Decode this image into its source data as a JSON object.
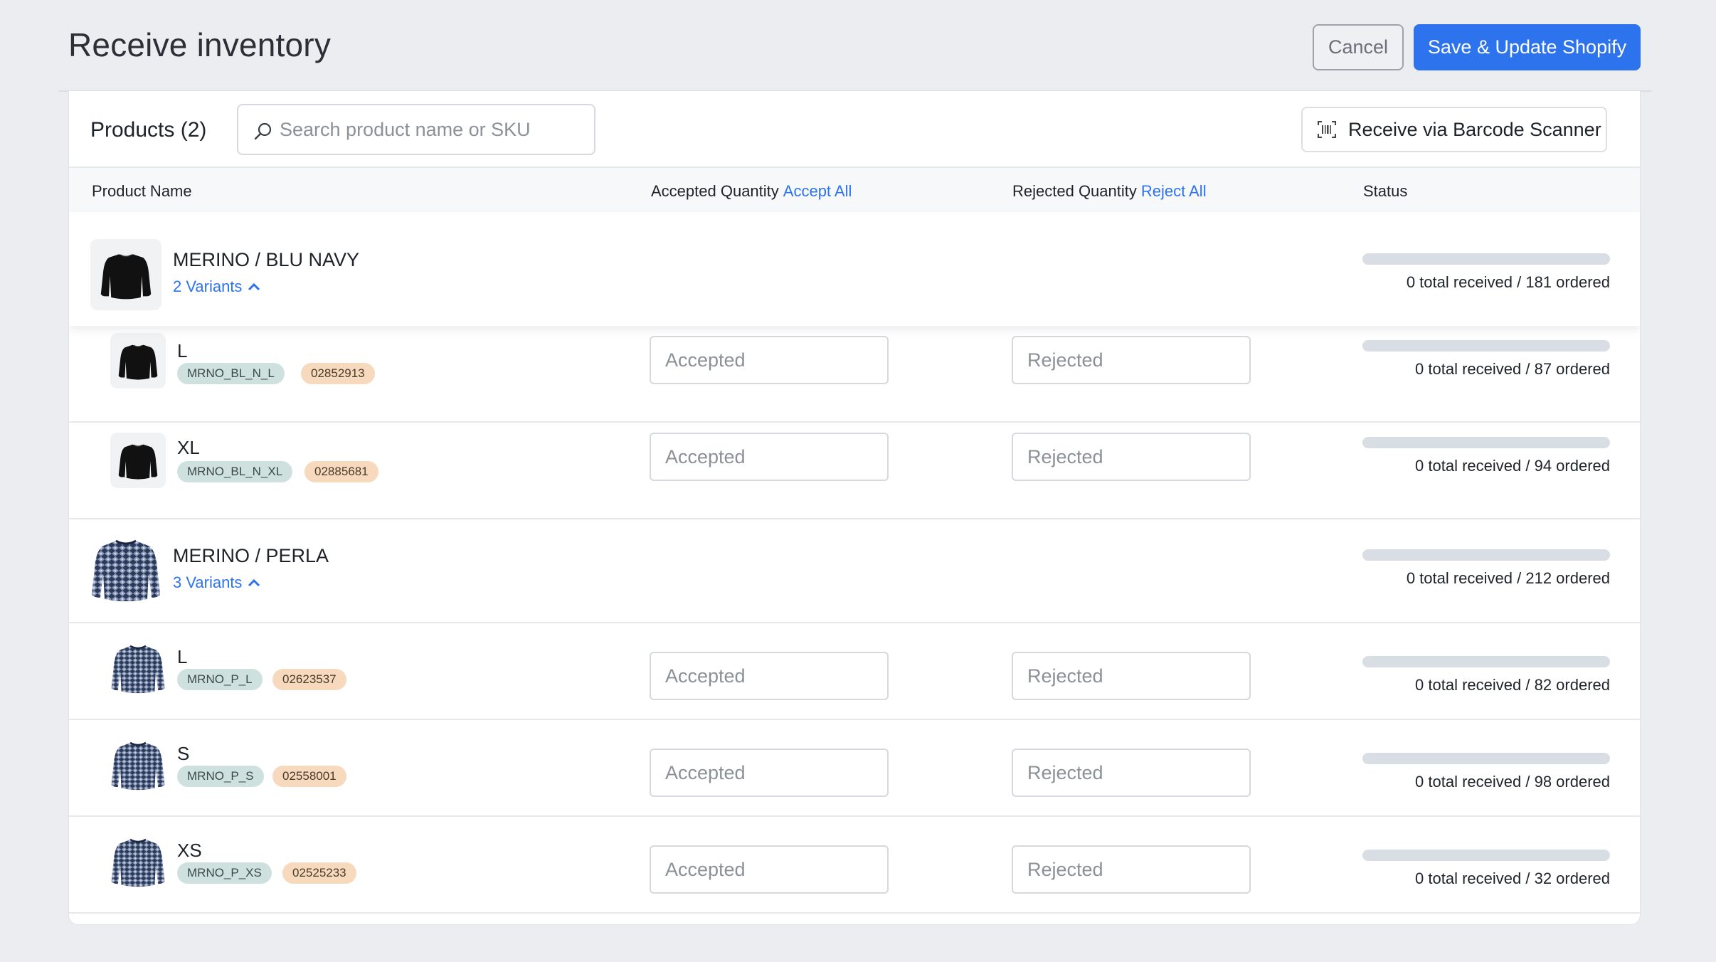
{
  "header": {
    "title": "Receive inventory",
    "cancel_label": "Cancel",
    "save_label": "Save & Update Shopify"
  },
  "toolbar": {
    "products_title": "Products (2)",
    "search_placeholder": "Search product name or SKU",
    "scanner_label": "Receive via Barcode Scanner"
  },
  "table": {
    "columns": {
      "product_name": "Product Name",
      "accepted_quantity": "Accepted Quantity",
      "accept_all": "Accept All",
      "rejected_quantity": "Rejected Quantity",
      "reject_all": "Reject All",
      "status": "Status"
    },
    "accepted_placeholder": "Accepted",
    "rejected_placeholder": "Rejected"
  },
  "products": [
    {
      "name": "MERINO / BLU NAVY",
      "variants_link": "2 Variants",
      "status": "0 total received / 181 ordered",
      "received_fraction": 0,
      "thumb_icon": "black-sweater-icon",
      "variants": [
        {
          "size": "L",
          "sku": "MRNO_BL_N_L",
          "code": "02852913",
          "status": "0 total received / 87 ordered",
          "received_fraction": 0
        },
        {
          "size": "XL",
          "sku": "MRNO_BL_N_XL",
          "code": "02885681",
          "status": "0 total received / 94 ordered",
          "received_fraction": 0
        }
      ]
    },
    {
      "name": "MERINO / PERLA",
      "variants_link": "3 Variants",
      "status": "0 total received / 212 ordered",
      "received_fraction": 0,
      "thumb_icon": "patterned-sweater-icon",
      "variants": [
        {
          "size": "L",
          "sku": "MRNO_P_L",
          "code": "02623537",
          "status": "0 total received / 82 ordered",
          "received_fraction": 0
        },
        {
          "size": "S",
          "sku": "MRNO_P_S",
          "code": "02558001",
          "status": "0 total received / 98 ordered",
          "received_fraction": 0
        },
        {
          "size": "XS",
          "sku": "MRNO_P_XS",
          "code": "02525233",
          "status": "0 total received / 32 ordered",
          "received_fraction": 0
        }
      ]
    }
  ]
}
